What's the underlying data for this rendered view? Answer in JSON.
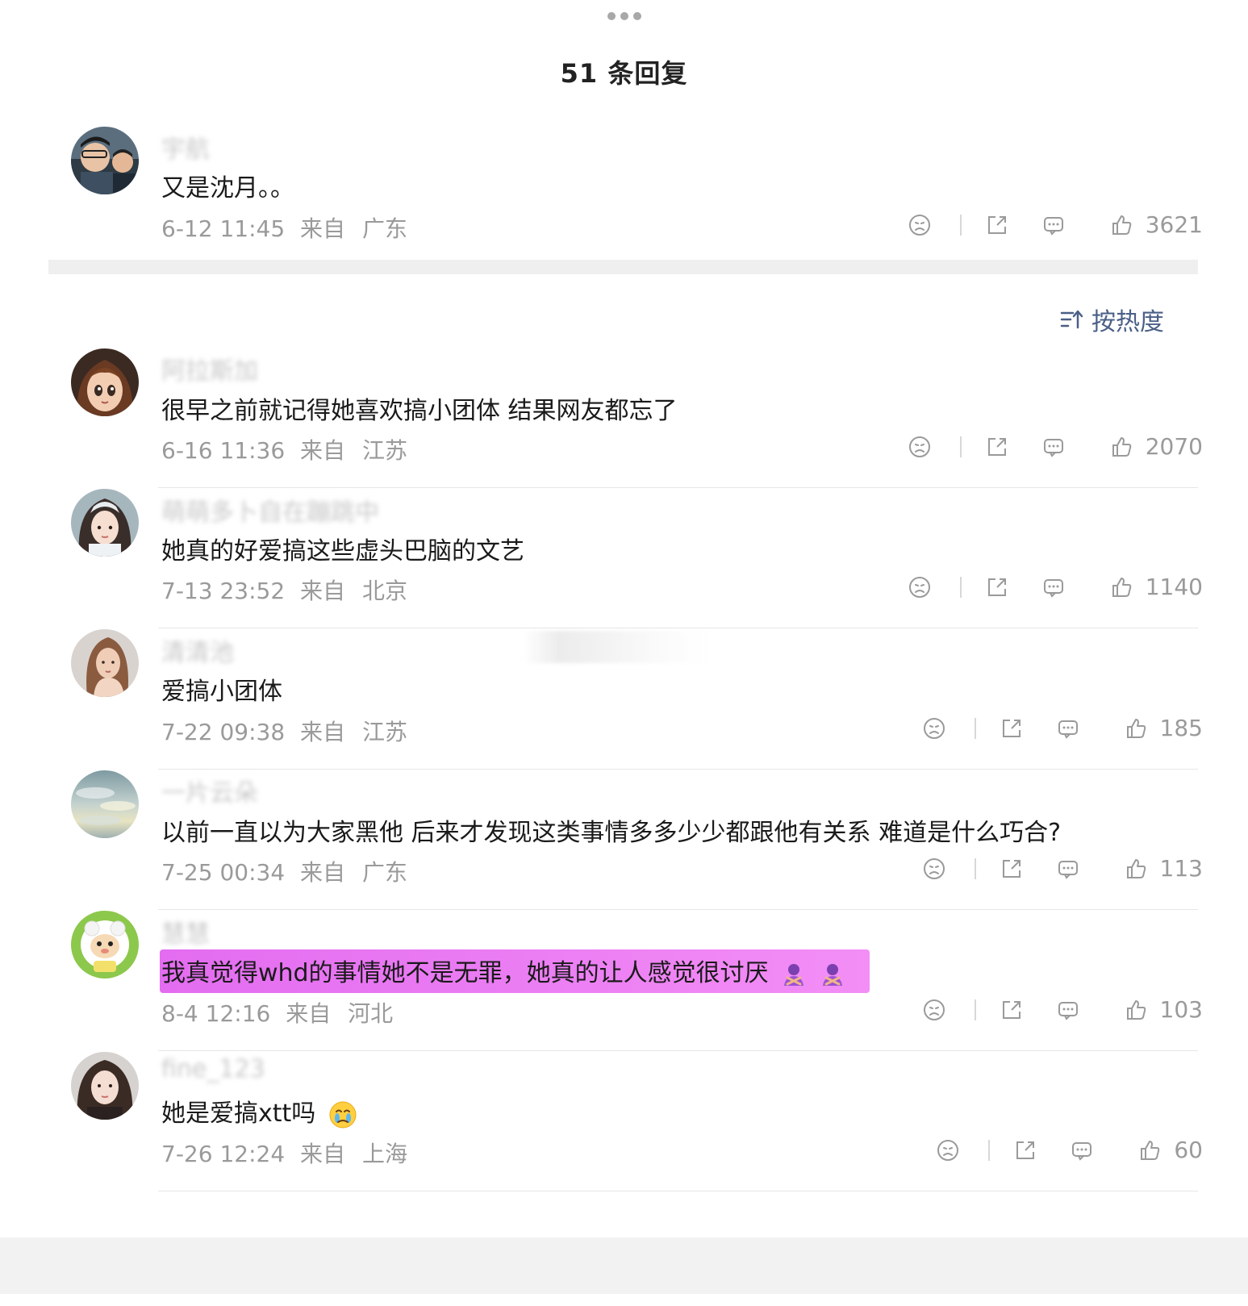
{
  "header": {
    "title": "51 条回复"
  },
  "sort": {
    "label": "按热度"
  },
  "root_comment": {
    "username": "宇航",
    "content": "又是沈月。。",
    "time": "6-12 11:45",
    "from_label": "来自",
    "location": "广东",
    "likes": "3621"
  },
  "replies": [
    {
      "username": "阿拉斯加",
      "content": "很早之前就记得她喜欢搞小团体 结果网友都忘了",
      "time": "6-16 11:36",
      "from_label": "来自",
      "location": "江苏",
      "likes": "2070"
    },
    {
      "username": "萌萌多卜自在蹦跳中",
      "content": "她真的好爱搞这些虚头巴脑的文艺",
      "time": "7-13 23:52",
      "from_label": "来自",
      "location": "北京",
      "likes": "1140"
    },
    {
      "username": "清清池",
      "content": "爱搞小团体",
      "time": "7-22 09:38",
      "from_label": "来自",
      "location": "江苏",
      "likes": "185"
    },
    {
      "username": "一片云朵",
      "content": "以前一直以为大家黑他 后来才发现这类事情多多少少都跟他有关系 难道是什么巧合?",
      "time": "7-25 00:34",
      "from_label": "来自",
      "location": "广东",
      "likes": "113"
    },
    {
      "username": "慧慧",
      "content": "我真觉得whd的事情她不是无罪，她真的让人感觉很讨厌",
      "time": "8-4 12:16",
      "from_label": "来自",
      "location": "河北",
      "likes": "103",
      "highlight_color": "#e66ff1"
    },
    {
      "username": "fine_123",
      "content": "她是爱搞xtt吗",
      "time": "7-26 12:24",
      "from_label": "来自",
      "location": "上海",
      "likes": "60"
    }
  ],
  "icons": {
    "dislike": "sad-face-icon",
    "share": "share-icon",
    "comment": "comment-icon",
    "like": "thumbs-up-icon",
    "sort": "sort-icon",
    "more": "more-dots-icon"
  },
  "colors": {
    "accent": "#4a5f86",
    "muted": "#9a9a9a",
    "highlight": "#e66ff1"
  }
}
